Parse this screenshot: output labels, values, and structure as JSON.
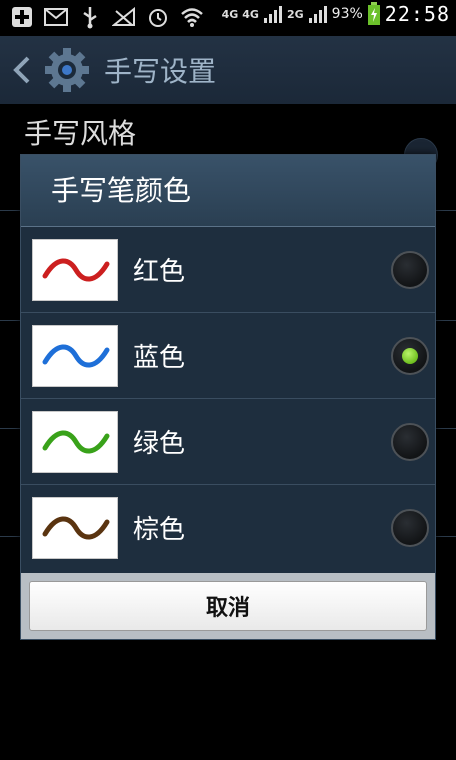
{
  "status_bar": {
    "network_1": "4G",
    "network_2": "4G",
    "network_3": "2G",
    "battery_percent": "93%",
    "time": "22:58"
  },
  "header": {
    "title": "手写设置"
  },
  "background": {
    "first_item": "手写风格"
  },
  "dialog": {
    "title": "手写笔颜色",
    "options": [
      {
        "label": "红色",
        "color": "#cc1f1f",
        "selected": false
      },
      {
        "label": "蓝色",
        "color": "#1e6fd8",
        "selected": true
      },
      {
        "label": "绿色",
        "color": "#39a21a",
        "selected": false
      },
      {
        "label": "棕色",
        "color": "#5a3410",
        "selected": false
      }
    ],
    "cancel_label": "取消"
  }
}
